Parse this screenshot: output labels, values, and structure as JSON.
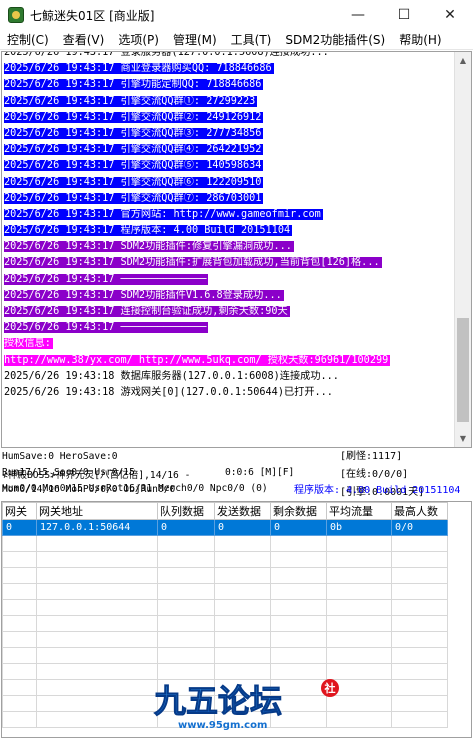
{
  "window": {
    "title": "七鲸迷失01区 [商业版]",
    "minimize": "—",
    "maximize": "☐",
    "close": "✕"
  },
  "menu": [
    "控制(C)",
    "查看(V)",
    "选项(P)",
    "管理(M)",
    "工具(T)",
    "SDM2功能插件(S)",
    "帮助(H)"
  ],
  "log": [
    {
      "text": "2025/6/26 19:43:17 登录服务器(127.0.0.1:5608)连接成功...",
      "style": "plain"
    },
    {
      "text": "2025/6/26 19:43:17 商业登录器购买QQ: 718846686",
      "style": "blue"
    },
    {
      "text": "2025/6/26 19:43:17 引擎功能定制QQ: 718846686",
      "style": "blue"
    },
    {
      "text": "2025/6/26 19:43:17 引擎交流QQ群①: 27299223",
      "style": "blue"
    },
    {
      "text": "2025/6/26 19:43:17 引擎交流QQ群②: 249126912",
      "style": "blue"
    },
    {
      "text": "2025/6/26 19:43:17 引擎交流QQ群③: 277734856",
      "style": "blue"
    },
    {
      "text": "2025/6/26 19:43:17 引擎交流QQ群④: 264221952",
      "style": "blue"
    },
    {
      "text": "2025/6/26 19:43:17 引擎交流QQ群⑤: 140598634",
      "style": "blue"
    },
    {
      "text": "2025/6/26 19:43:17 引擎交流QQ群⑥: 122209510",
      "style": "blue"
    },
    {
      "text": "2025/6/26 19:43:17 引擎交流QQ群⑦: 286703001",
      "style": "blue"
    },
    {
      "text": "2025/6/26 19:43:17 官方网站: http://www.gameofmir.com",
      "style": "blue"
    },
    {
      "text": "2025/6/26 19:43:17 程序版本: 4.00 Build 20151104",
      "style": "blue"
    },
    {
      "text": "2025/6/26 19:43:17 SDM2功能插件:修复引擎漏洞成功...",
      "style": "purple"
    },
    {
      "text": "2025/6/26 19:43:17 SDM2功能插件:扩展背包加载成功,当前背包[126]格...",
      "style": "purple"
    },
    {
      "text": "2025/6/26 19:43:17 ──────────────",
      "style": "purple"
    },
    {
      "text": "2025/6/26 19:43:17 SDM2功能插件V1.6.8登录成功...",
      "style": "purple"
    },
    {
      "text": "2025/6/26 19:43:17 连接控制台验证成功,剩余天数:90天",
      "style": "purple"
    },
    {
      "text": "2025/6/26 19:43:17 ──────────────",
      "style": "purple"
    },
    {
      "text": "授权信息:",
      "style": "magenta"
    },
    {
      "text": "http://www.387yx.com/ http://www.5ukq.com/ 授权天数:96961/100299",
      "style": "magenta"
    },
    {
      "text": "2025/6/26 19:43:18 数据库服务器(127.0.0.1:6008)连接成功...",
      "style": "plain"
    },
    {
      "text": "2025/6/26 19:43:18 游戏网关[0](127.0.0.1:50644)已打开...",
      "style": "plain"
    }
  ],
  "status": {
    "line1": "HumSave:0 HeroSave:0",
    "line2a": "Run17/15 Soc0/0 Usr0/15",
    "line2b": "0:0:6 [M][F]",
    "line3": "Hum0/0 Mon0/15 UsrRot16/31 Merch0/0 Npc0/0 (0)",
    "line4": "≮神殿BOSS≯神界元灵[八百亿倍],14/16 -",
    "line5": "Mon0/14/16 MonP0/0/0 ObjRun0/0",
    "refresh": "[刷怪:1117]",
    "online": "[在线:0/0/0]",
    "engine": "[引擎:0.0001天]",
    "version": "程序版本: 4.00 Build 20151104"
  },
  "table": {
    "headers": [
      "网关",
      "网关地址",
      "队列数据",
      "发送数据",
      "剩余数据",
      "平均流量",
      "最高人数"
    ],
    "rows": [
      [
        "0",
        "127.0.0.1:50644",
        "0",
        "0",
        "0",
        "0b",
        "0/0"
      ]
    ]
  },
  "logo": {
    "text": "九五论坛",
    "url": "www.95gm.com",
    "badge": "社"
  }
}
